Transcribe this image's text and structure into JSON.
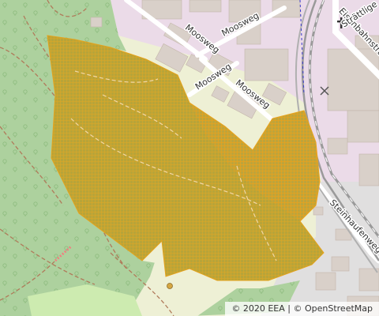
{
  "map": {
    "streets": {
      "moosweg_upper": "Moosweg",
      "moosweg_left": "Moosweg",
      "moosweg_lower": "Moosweg",
      "eisenbahnstrasse": "Eisenbahnstraße",
      "strattligen": "Strättlige",
      "steinhaufenweg": "Steinhaufenweg"
    },
    "overlay": {
      "fill_color": "#f0a830",
      "hatch_color": "#e8a21c"
    },
    "colors": {
      "forest": "#add19e",
      "industrial": "#ebdbe8",
      "building": "#d9d0c9",
      "farmland": "#eef0d5",
      "railway": "#919191"
    },
    "icons": [
      "church-icon",
      "tree-icon",
      "viewpoint-icon"
    ]
  },
  "attribution": {
    "copyright": "© 2020 EEA",
    "separator": "|",
    "osm": "© OpenStreetMap"
  }
}
